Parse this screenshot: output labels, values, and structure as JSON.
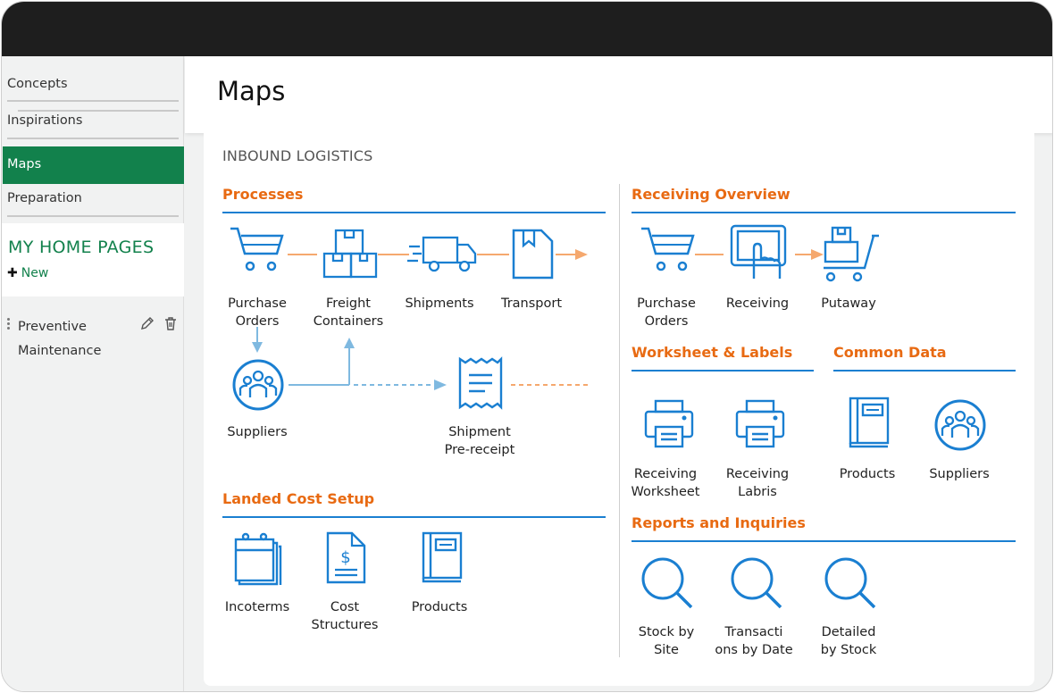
{
  "sidebar": {
    "items": [
      {
        "label": "Concepts"
      },
      {
        "label": "Inspirations"
      },
      {
        "label": "Maps"
      },
      {
        "label": "Preparation"
      }
    ],
    "home_pages_title": "MY HOME PAGES",
    "new_label": "New",
    "home_pages": [
      {
        "label": "Preventive\nMaintenance"
      }
    ]
  },
  "header": {
    "title": "Maps"
  },
  "map": {
    "subtitle": "INBOUND LOGISTICS",
    "processes": {
      "title": "Processes",
      "purchase_orders": "Purchase\nOrders",
      "freight_containers": "Freight\nContainers",
      "shipments": "Shipments",
      "transport": "Transport",
      "suppliers": "Suppliers",
      "shipment_prereceipt": "Shipment\nPre-receipt"
    },
    "landed_cost": {
      "title": "Landed Cost Setup",
      "incoterms": "Incoterms",
      "cost_structures": "Cost\nStructures",
      "products": "Products"
    },
    "receiving": {
      "title": "Receiving Overview",
      "purchase_orders": "Purchase\nOrders",
      "receiving": "Receiving",
      "putaway": "Putaway"
    },
    "worksheet": {
      "title": "Worksheet & Labels",
      "receiving_worksheet": "Receiving\nWorksheet",
      "receiving_labris": "Receiving\nLabris"
    },
    "common": {
      "title": "Common Data",
      "products": "Products",
      "suppliers": "Suppliers"
    },
    "reports": {
      "title": "Reports and Inquiries",
      "stock_by_site": "Stock by\nSite",
      "transactions_by_date": "Transacti\nons by Date",
      "detailed_by_stock": "Detailed\nby Stock"
    }
  },
  "colors": {
    "accent_green": "#12814c",
    "section_orange": "#e86a12",
    "icon_blue": "#1a7fd1",
    "flow_orange": "#f5a86e",
    "flow_blue": "#7fb9e0"
  }
}
